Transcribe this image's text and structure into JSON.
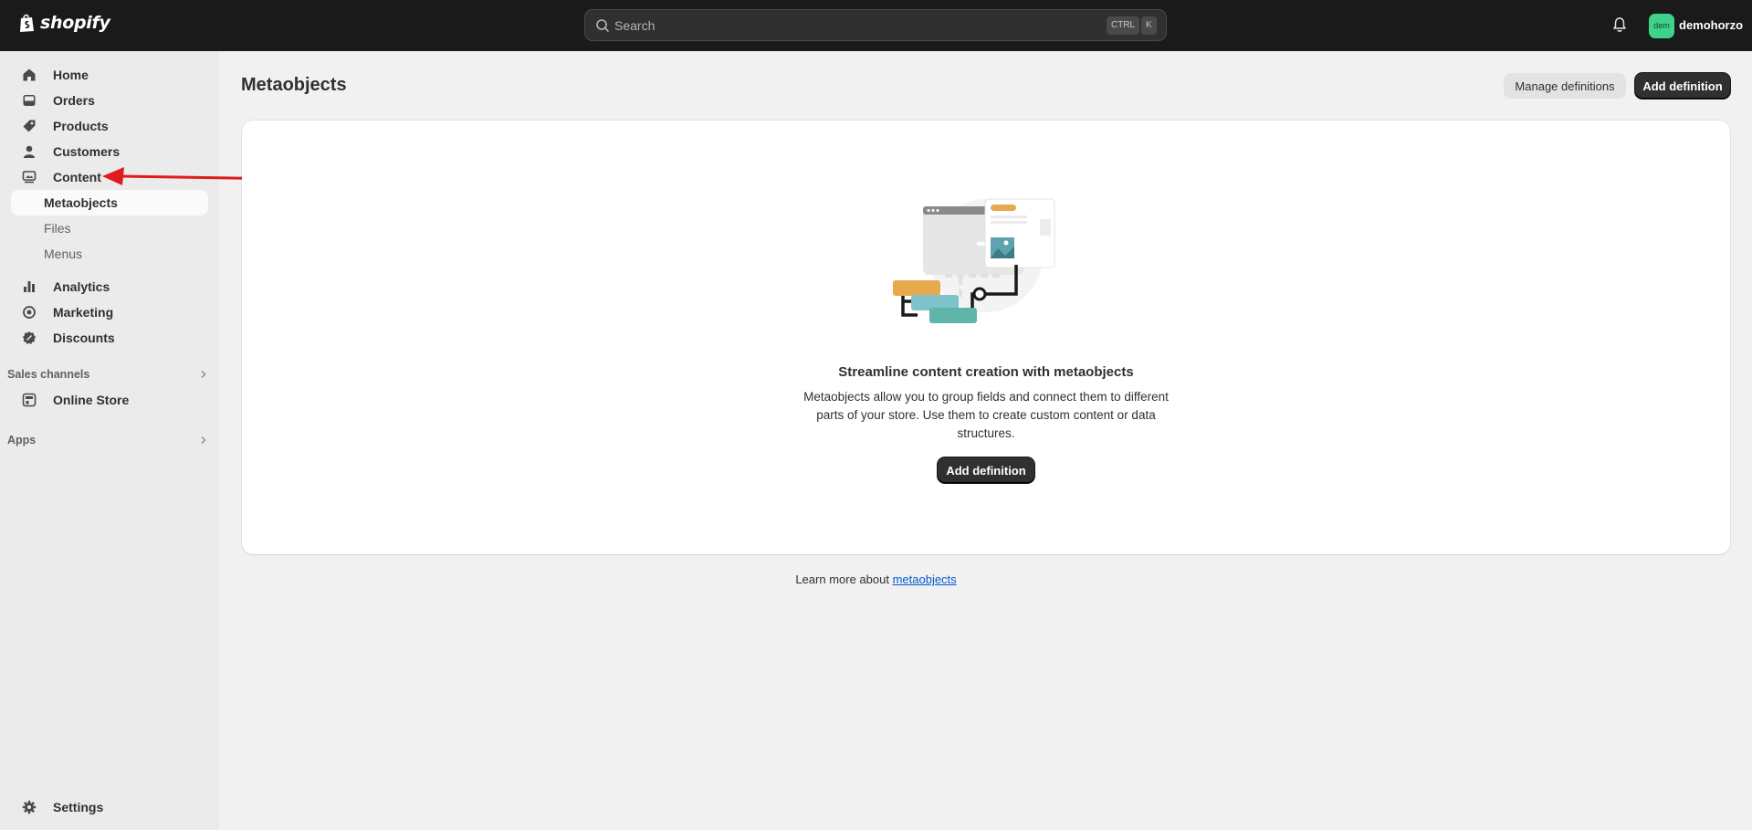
{
  "topbar": {
    "logo_text": "shopify",
    "search_placeholder": "Search",
    "shortcut_key1": "CTRL",
    "shortcut_key2": "K",
    "avatar_initials": "dem",
    "store_name": "demohorzo"
  },
  "sidebar": {
    "items": [
      {
        "label": "Home",
        "icon": "home-icon"
      },
      {
        "label": "Orders",
        "icon": "inbox-icon"
      },
      {
        "label": "Products",
        "icon": "tag-icon"
      },
      {
        "label": "Customers",
        "icon": "person-icon"
      },
      {
        "label": "Content",
        "icon": "image-board-icon"
      }
    ],
    "content_sub": [
      "Metaobjects",
      "Files",
      "Menus"
    ],
    "items2": [
      {
        "label": "Analytics",
        "icon": "bar-chart-icon"
      },
      {
        "label": "Marketing",
        "icon": "target-icon"
      },
      {
        "label": "Discounts",
        "icon": "discount-icon"
      }
    ],
    "sales_channels_label": "Sales channels",
    "online_store_label": "Online Store",
    "apps_label": "Apps",
    "settings_label": "Settings"
  },
  "main": {
    "title": "Metaobjects",
    "manage_label": "Manage definitions",
    "add_label": "Add definition",
    "empty_heading": "Streamline content creation with metaobjects",
    "empty_description": "Metaobjects allow you to group fields and connect them to different parts of your store. Use them to create custom content or data structures.",
    "empty_button": "Add definition",
    "learn_prefix": "Learn more about",
    "learn_link": "metaobjects"
  },
  "colors": {
    "topbar": "#1a1a1a",
    "sidebar": "#ebebeb",
    "primary_button": "#303030",
    "link": "#005bd3",
    "annotation_arrow": "#e01b1b",
    "avatar": "#3fd28a"
  }
}
